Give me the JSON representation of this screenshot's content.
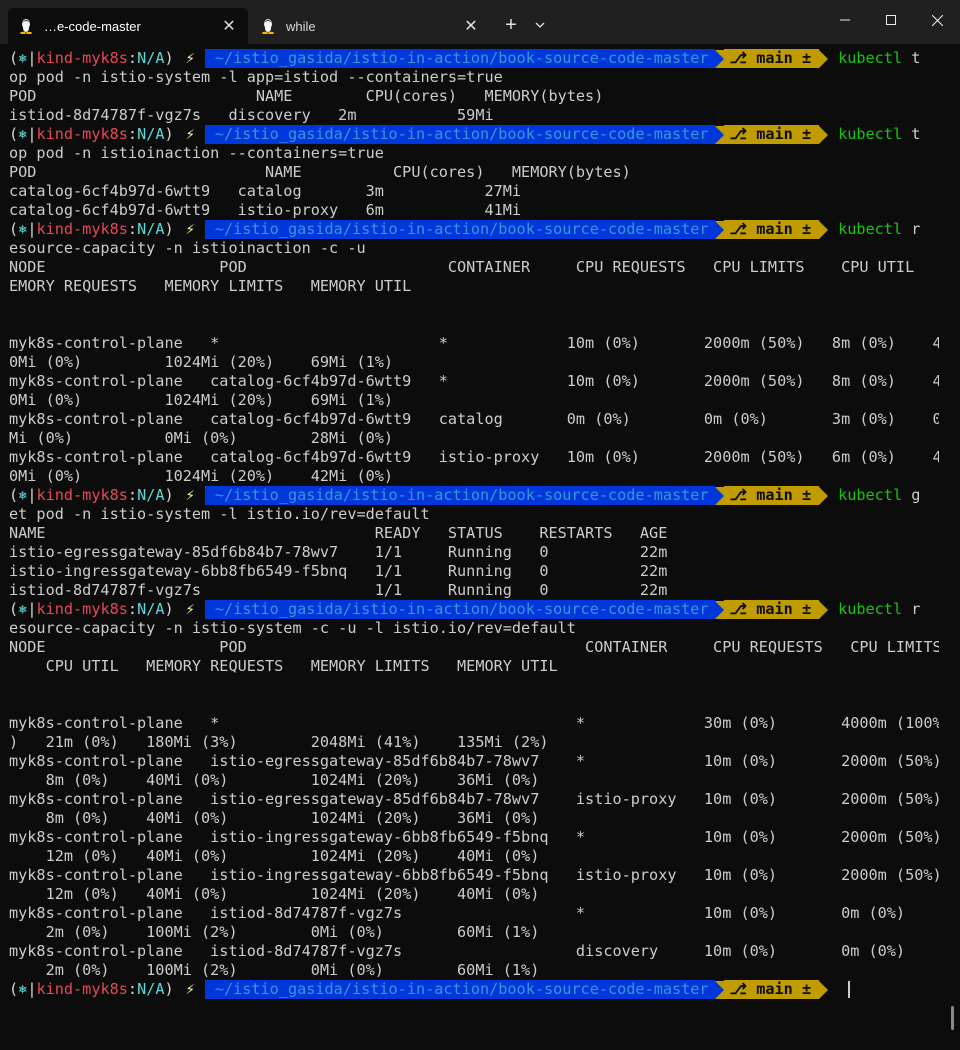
{
  "tabs": [
    {
      "label": "…e-code-master",
      "icon": "linux-penguin-icon",
      "active": true
    },
    {
      "label": "while",
      "icon": "linux-penguin-icon",
      "active": false
    }
  ],
  "prompt": {
    "k8s_open": "(",
    "k8s_glyph": "⎈",
    "context": "kind-myk8s",
    "sep": ":",
    "namespace": "N/A",
    "k8s_close": ")",
    "bolt": "⚡",
    "dir": "~/istio_gasida/istio-in-action/book-source-code-master",
    "git": "⎇ main ±"
  },
  "colors": {
    "background": "#0c0c0c",
    "dir_bg": "#0037da",
    "git_bg": "#c19c00",
    "command": "#16c60c",
    "context": "#e74856"
  },
  "lines": [
    {
      "type": "prompt",
      "cmd": "kubectl",
      "rest": " t"
    },
    {
      "type": "text",
      "text": "op pod -n istio-system -l app=istiod --containers=true"
    },
    {
      "type": "text",
      "text": "POD                        NAME        CPU(cores)   MEMORY(bytes)"
    },
    {
      "type": "text",
      "text": "istiod-8d74787f-vgz7s   discovery   2m           59Mi"
    },
    {
      "type": "prompt",
      "cmd": "kubectl",
      "rest": " t"
    },
    {
      "type": "text",
      "text": "op pod -n istioinaction --containers=true"
    },
    {
      "type": "text",
      "text": "POD                         NAME          CPU(cores)   MEMORY(bytes)"
    },
    {
      "type": "text",
      "text": "catalog-6cf4b97d-6wtt9   catalog       3m           27Mi"
    },
    {
      "type": "text",
      "text": "catalog-6cf4b97d-6wtt9   istio-proxy   6m           41Mi"
    },
    {
      "type": "prompt",
      "cmd": "kubectl",
      "rest": " r"
    },
    {
      "type": "text",
      "text": "esource-capacity -n istioinaction -c -u"
    },
    {
      "type": "text",
      "text": "NODE                   POD                      CONTAINER     CPU REQUESTS   CPU LIMITS    CPU UTIL   M"
    },
    {
      "type": "text",
      "text": "EMORY REQUESTS   MEMORY LIMITS   MEMORY UTIL"
    },
    {
      "type": "text",
      "text": ""
    },
    {
      "type": "text",
      "text": ""
    },
    {
      "type": "text",
      "text": "myk8s-control-plane   *                        *             10m (0%)       2000m (50%)   8m (0%)    4"
    },
    {
      "type": "text",
      "text": "0Mi (0%)         1024Mi (20%)    69Mi (1%)"
    },
    {
      "type": "text",
      "text": "myk8s-control-plane   catalog-6cf4b97d-6wtt9   *             10m (0%)       2000m (50%)   8m (0%)    4"
    },
    {
      "type": "text",
      "text": "0Mi (0%)         1024Mi (20%)    69Mi (1%)"
    },
    {
      "type": "text",
      "text": "myk8s-control-plane   catalog-6cf4b97d-6wtt9   catalog       0m (0%)        0m (0%)       3m (0%)    0"
    },
    {
      "type": "text",
      "text": "Mi (0%)          0Mi (0%)        28Mi (0%)"
    },
    {
      "type": "text",
      "text": "myk8s-control-plane   catalog-6cf4b97d-6wtt9   istio-proxy   10m (0%)       2000m (50%)   6m (0%)    4"
    },
    {
      "type": "text",
      "text": "0Mi (0%)         1024Mi (20%)    42Mi (0%)"
    },
    {
      "type": "prompt",
      "cmd": "kubectl",
      "rest": " g"
    },
    {
      "type": "text",
      "text": "et pod -n istio-system -l istio.io/rev=default"
    },
    {
      "type": "text",
      "text": "NAME                                    READY   STATUS    RESTARTS   AGE"
    },
    {
      "type": "text",
      "text": "istio-egressgateway-85df6b84b7-78wv7    1/1     Running   0          22m"
    },
    {
      "type": "text",
      "text": "istio-ingressgateway-6bb8fb6549-f5bnq   1/1     Running   0          22m"
    },
    {
      "type": "text",
      "text": "istiod-8d74787f-vgz7s                   1/1     Running   0          22m"
    },
    {
      "type": "prompt",
      "cmd": "kubectl",
      "rest": " r"
    },
    {
      "type": "text",
      "text": "esource-capacity -n istio-system -c -u -l istio.io/rev=default"
    },
    {
      "type": "text",
      "text": "NODE                   POD                                     CONTAINER     CPU REQUESTS   CPU LIMITS"
    },
    {
      "type": "text",
      "text": "    CPU UTIL   MEMORY REQUESTS   MEMORY LIMITS   MEMORY UTIL"
    },
    {
      "type": "text",
      "text": ""
    },
    {
      "type": "text",
      "text": ""
    },
    {
      "type": "text",
      "text": "myk8s-control-plane   *                                       *             30m (0%)       4000m (100%"
    },
    {
      "type": "text",
      "text": ")   21m (0%)   180Mi (3%)        2048Mi (41%)    135Mi (2%)"
    },
    {
      "type": "text",
      "text": "myk8s-control-plane   istio-egressgateway-85df6b84b7-78wv7    *             10m (0%)       2000m (50%)"
    },
    {
      "type": "text",
      "text": "    8m (0%)    40Mi (0%)         1024Mi (20%)    36Mi (0%)"
    },
    {
      "type": "text",
      "text": "myk8s-control-plane   istio-egressgateway-85df6b84b7-78wv7    istio-proxy   10m (0%)       2000m (50%)"
    },
    {
      "type": "text",
      "text": "    8m (0%)    40Mi (0%)         1024Mi (20%)    36Mi (0%)"
    },
    {
      "type": "text",
      "text": "myk8s-control-plane   istio-ingressgateway-6bb8fb6549-f5bnq   *             10m (0%)       2000m (50%)"
    },
    {
      "type": "text",
      "text": "    12m (0%)   40Mi (0%)         1024Mi (20%)    40Mi (0%)"
    },
    {
      "type": "text",
      "text": "myk8s-control-plane   istio-ingressgateway-6bb8fb6549-f5bnq   istio-proxy   10m (0%)       2000m (50%)"
    },
    {
      "type": "text",
      "text": "    12m (0%)   40Mi (0%)         1024Mi (20%)    40Mi (0%)"
    },
    {
      "type": "text",
      "text": "myk8s-control-plane   istiod-8d74787f-vgz7s                   *             10m (0%)       0m (0%)"
    },
    {
      "type": "text",
      "text": "    2m (0%)    100Mi (2%)        0Mi (0%)        60Mi (1%)"
    },
    {
      "type": "text",
      "text": "myk8s-control-plane   istiod-8d74787f-vgz7s                   discovery     10m (0%)       0m (0%)"
    },
    {
      "type": "text",
      "text": "    2m (0%)    100Mi (2%)        0Mi (0%)        60Mi (1%)"
    },
    {
      "type": "prompt",
      "cmd": "",
      "rest": "",
      "cursor": true
    }
  ]
}
